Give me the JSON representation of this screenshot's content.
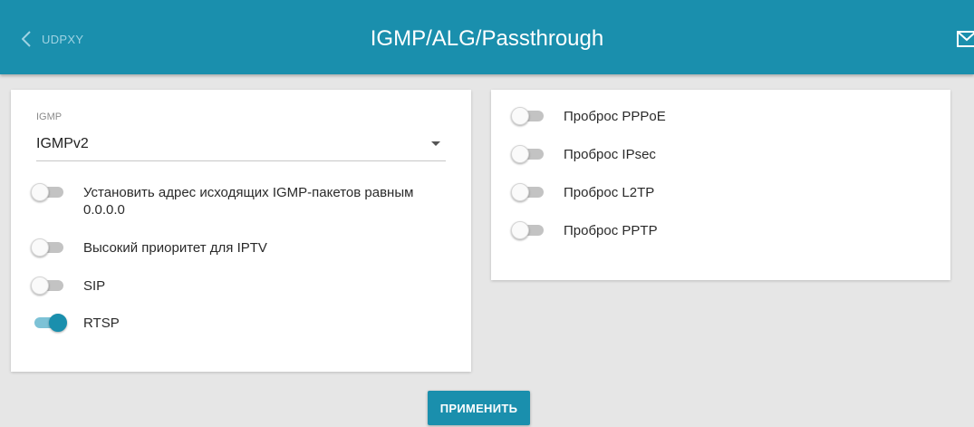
{
  "header": {
    "back_label": "UDPXY",
    "title": "IGMP/ALG/Passthrough"
  },
  "colors": {
    "accent": "#1a8fad",
    "background": "#e6e6e6"
  },
  "igmp": {
    "label": "IGMP",
    "selected_value": "IGMPv2"
  },
  "left_toggles": [
    {
      "label": "Установить адрес исходящих IGMP-пакетов равным 0.0.0.0",
      "on": false
    },
    {
      "label": "Высокий приоритет для IPTV",
      "on": false
    },
    {
      "label": "SIP",
      "on": false
    },
    {
      "label": "RTSP",
      "on": true
    }
  ],
  "right_toggles": [
    {
      "label": "Проброс PPPoE",
      "on": false
    },
    {
      "label": "Проброс IPsec",
      "on": false
    },
    {
      "label": "Проброс L2TP",
      "on": false
    },
    {
      "label": "Проброс PPTP",
      "on": false
    }
  ],
  "apply_label": "ПРИМЕНИТЬ"
}
